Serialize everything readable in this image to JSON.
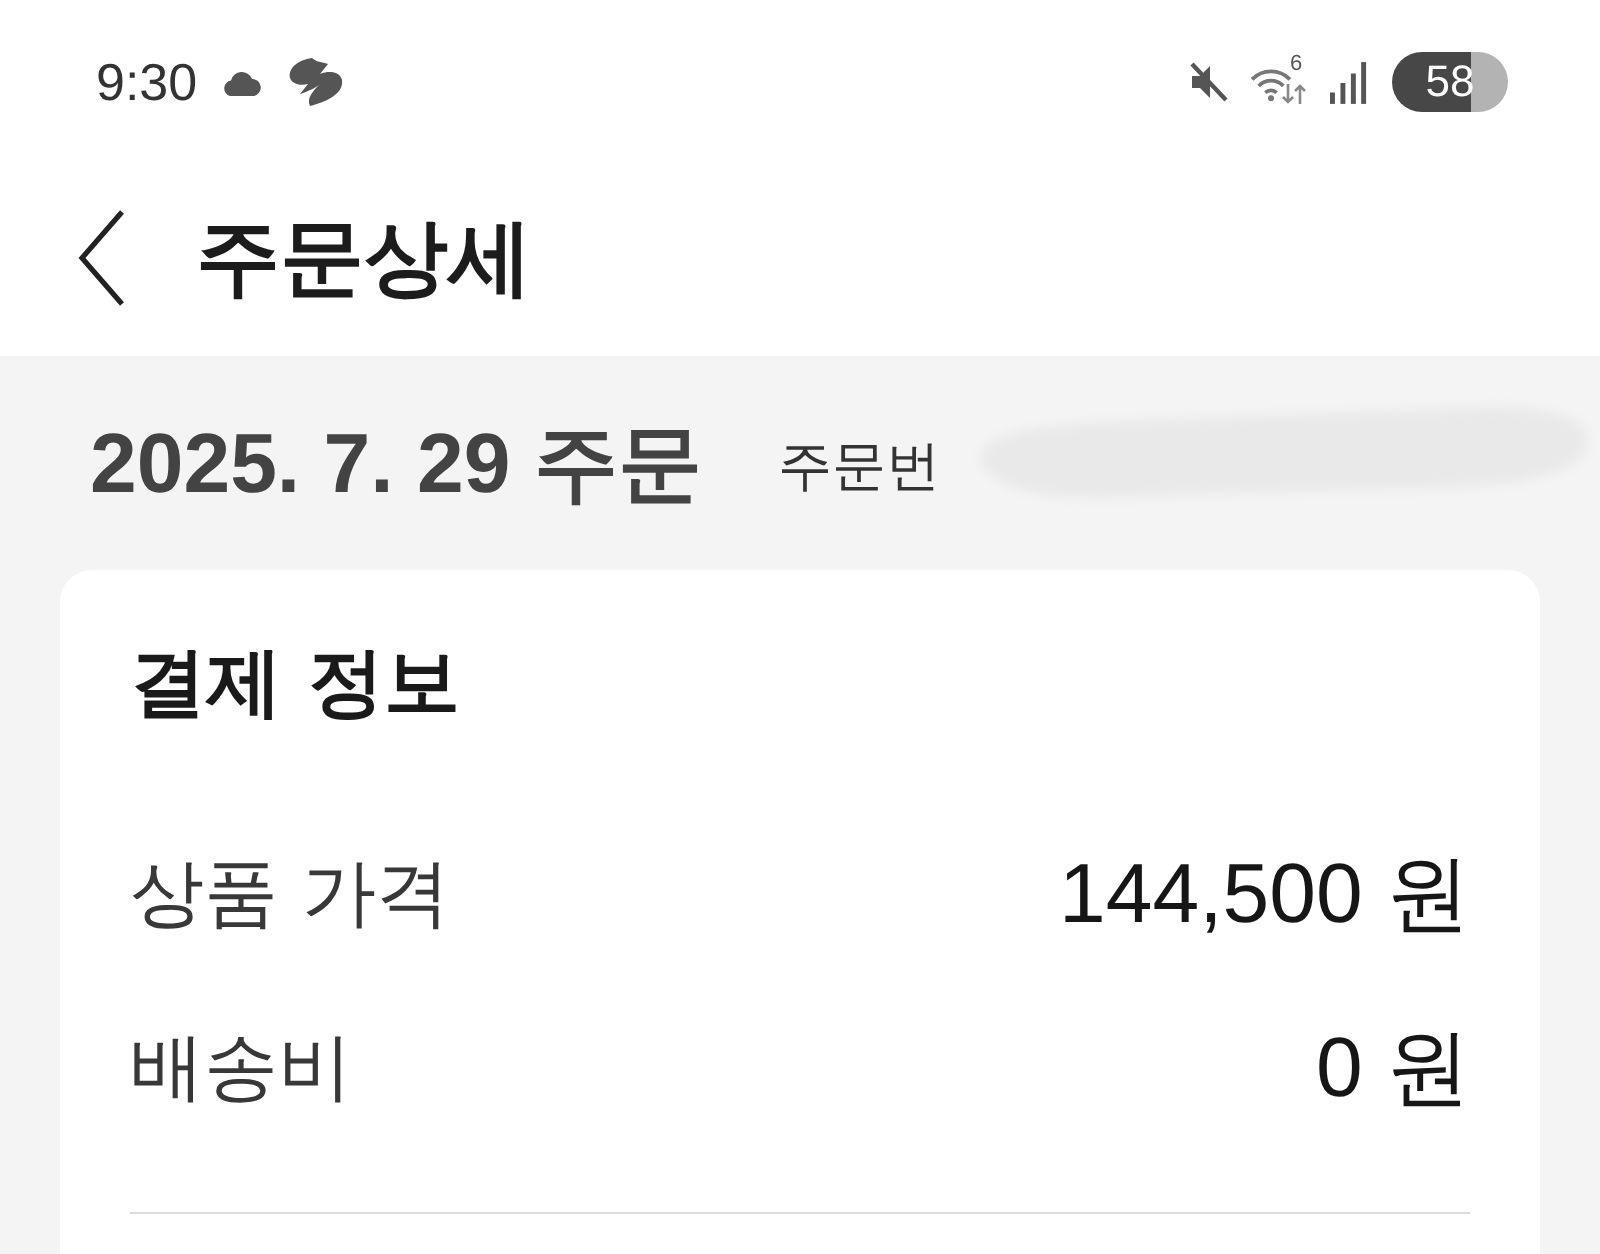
{
  "status_bar": {
    "time": "9:30",
    "wifi_badge": "6",
    "battery": "58"
  },
  "header": {
    "title": "주문상세"
  },
  "order": {
    "date": "2025. 7. 29 주문",
    "number_label": "주문번"
  },
  "payment_card": {
    "title": "결제 정보",
    "rows": [
      {
        "label": "상품 가격",
        "value": "144,500 원"
      },
      {
        "label": "배송비",
        "value": "0 원"
      }
    ]
  }
}
